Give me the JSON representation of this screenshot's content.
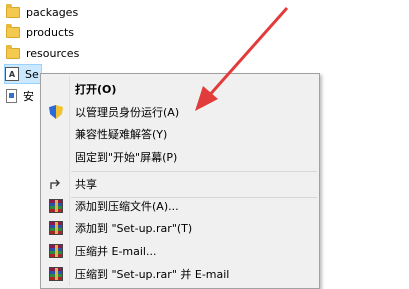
{
  "files": [
    {
      "name": "packages",
      "icon": "folder-icon"
    },
    {
      "name": "products",
      "icon": "folder-icon"
    },
    {
      "name": "resources",
      "icon": "folder-icon"
    },
    {
      "name": "Se",
      "icon": "exe-icon"
    },
    {
      "name": "安",
      "icon": "doc-icon"
    }
  ],
  "menu": {
    "open": "打开(O)",
    "run_as_admin": "以管理员身份运行(A)",
    "compat_troubleshoot": "兼容性疑难解答(Y)",
    "pin_to_start": "固定到\"开始\"屏幕(P)",
    "share": "共享",
    "add_to_archive": "添加到压缩文件(A)...",
    "add_to_rar": "添加到 \"Set-up.rar\"(T)",
    "compress_email": "压缩并 E-mail...",
    "compress_rar_email": "压缩到 \"Set-up.rar\" 并 E-mail"
  },
  "colors": {
    "annotation_arrow": "#e23b3b",
    "selection": "#cce8ff"
  }
}
